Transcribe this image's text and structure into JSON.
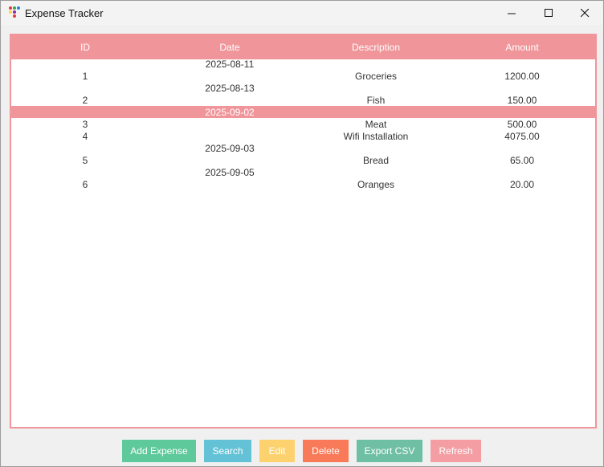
{
  "window": {
    "title": "Expense Tracker",
    "controls": {
      "minimize": "minimize",
      "maximize": "maximize",
      "close": "close"
    }
  },
  "table": {
    "headers": {
      "id": "ID",
      "date": "Date",
      "description": "Description",
      "amount": "Amount"
    },
    "rows": [
      {
        "id": "1",
        "date": "2025-08-11",
        "description": "Groceries",
        "amount": "1200.00"
      },
      {
        "id": "2",
        "date": "2025-08-13",
        "description": "Fish",
        "amount": "150.00"
      },
      {
        "id": "3",
        "date": "2025-09-02",
        "description": "Meat",
        "amount": "500.00",
        "selected": true
      },
      {
        "id": "4",
        "date": "",
        "description": "Wifi Installation",
        "amount": "4075.00"
      },
      {
        "id": "5",
        "date": "2025-09-03",
        "description": "Bread",
        "amount": "65.00"
      },
      {
        "id": "6",
        "date": "2025-09-05",
        "description": "Oranges",
        "amount": "20.00"
      }
    ]
  },
  "toolbar": {
    "add_label": "Add Expense",
    "search_label": "Search",
    "edit_label": "Edit",
    "delete_label": "Delete",
    "export_label": "Export CSV",
    "refresh_label": "Refresh"
  },
  "colors": {
    "header_bg": "#f0959a",
    "add": "#5ec99a",
    "search": "#63c2d6",
    "edit": "#fdd26e",
    "delete": "#f97a58",
    "export": "#6fbfa5",
    "refresh": "#f49ea3"
  },
  "icons": {
    "app": "app-dots-icon"
  }
}
